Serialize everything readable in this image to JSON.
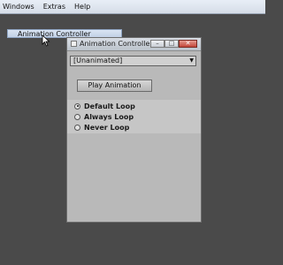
{
  "menubar": {
    "items": [
      "Windows",
      "Extras",
      "Help"
    ]
  },
  "dropdown": {
    "item_label": "Animation Controller"
  },
  "window": {
    "title": "Animation Controller",
    "controls": {
      "minimize": "–",
      "maximize": "□",
      "close": "✕"
    },
    "select": {
      "value": "[Unanimated]",
      "arrow": "▼"
    },
    "play_button_label": "Play Animation",
    "radios": [
      {
        "label": "Default Loop",
        "checked": true
      },
      {
        "label": "Always Loop",
        "checked": false
      },
      {
        "label": "Never Loop",
        "checked": false
      }
    ]
  },
  "colors": {
    "background": "#4a4a4a",
    "window_body": "#b9b9b9",
    "menu_highlight": "#c2d1e6"
  }
}
